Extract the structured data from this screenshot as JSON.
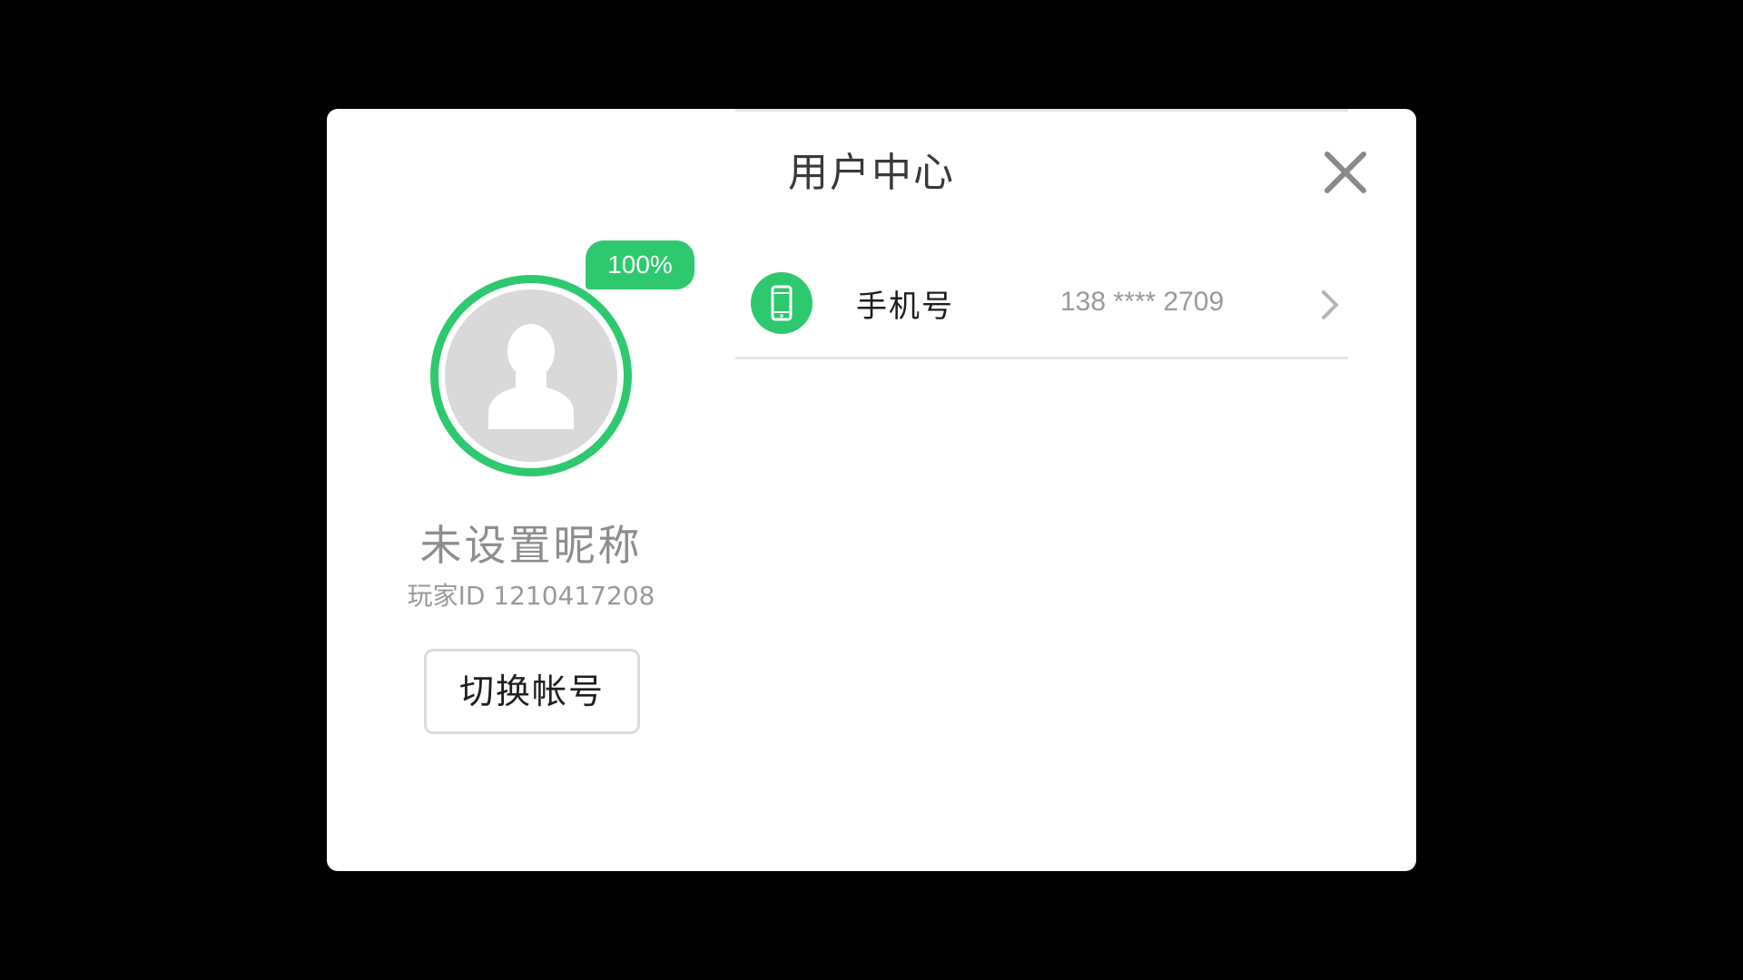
{
  "dialog": {
    "title": "用户中心",
    "close_icon": "close-icon"
  },
  "profile": {
    "completion_badge": "100%",
    "avatar_icon": "user-silhouette-icon",
    "nickname": "未设置昵称",
    "player_id": "玩家ID 1210417208",
    "switch_account_label": "切换帐号"
  },
  "settings": {
    "items": [
      {
        "icon": "mobile-phone-icon",
        "label": "手机号",
        "value": "138 **** 2709",
        "trailing_icon": "chevron-right-icon"
      }
    ]
  },
  "colors": {
    "accent": "#2ec96e",
    "background": "#000000",
    "dialog": "#ffffff",
    "muted_text": "#9a9a9a"
  }
}
